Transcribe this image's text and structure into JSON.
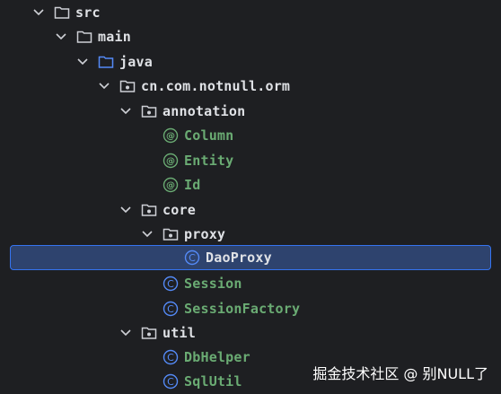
{
  "project_tree": {
    "nodes": [
      {
        "label": "src",
        "kind": "folder"
      },
      {
        "label": "main",
        "kind": "folder"
      },
      {
        "label": "java",
        "kind": "source-folder"
      },
      {
        "label": "cn.com.notnull.orm",
        "kind": "package"
      },
      {
        "label": "annotation",
        "kind": "package"
      },
      {
        "label": "Column",
        "kind": "annotation"
      },
      {
        "label": "Entity",
        "kind": "annotation"
      },
      {
        "label": "Id",
        "kind": "annotation"
      },
      {
        "label": "core",
        "kind": "package"
      },
      {
        "label": "proxy",
        "kind": "package"
      },
      {
        "label": "DaoProxy",
        "kind": "class",
        "selected": true
      },
      {
        "label": "Session",
        "kind": "class"
      },
      {
        "label": "SessionFactory",
        "kind": "class"
      },
      {
        "label": "util",
        "kind": "package"
      },
      {
        "label": "DbHelper",
        "kind": "class"
      },
      {
        "label": "SqlUtil",
        "kind": "class"
      }
    ]
  },
  "watermark": "掘金技术社区 @ 别NULL了",
  "colors": {
    "background": "#1e1f22",
    "selection_bg": "#2e436e",
    "selection_border": "#3574f0",
    "annotation_text": "#6aab73",
    "class_icon": "#548af7",
    "folder_text": "#dfe1e5"
  }
}
